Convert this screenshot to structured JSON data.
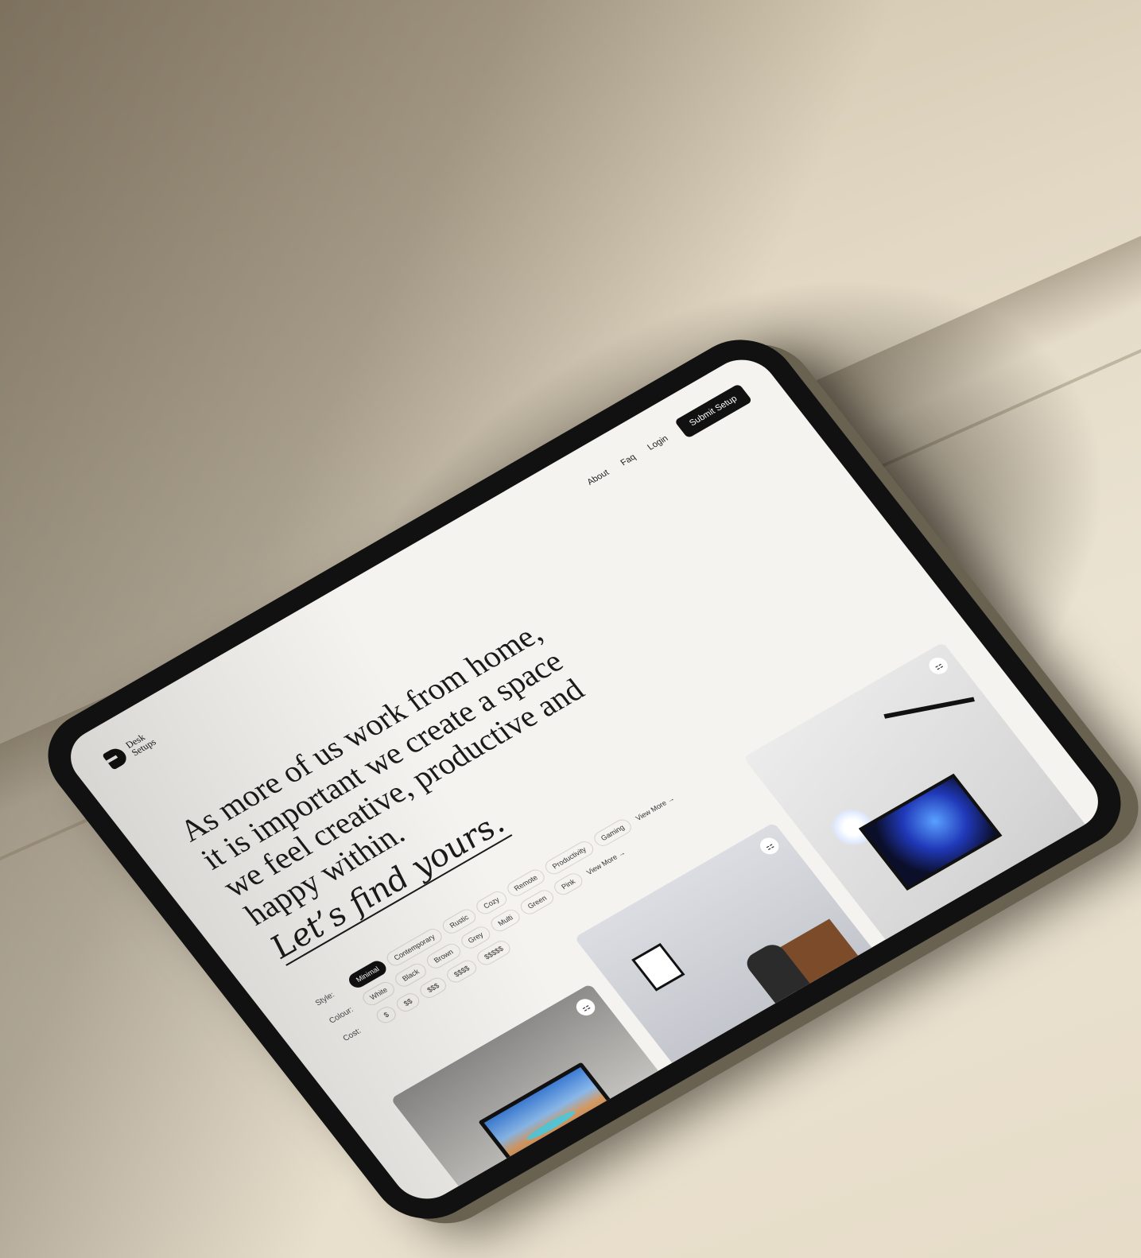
{
  "brand": {
    "line1": "Desk",
    "line2": "Setups"
  },
  "nav": {
    "about": "About",
    "faq": "Faq",
    "login": "Login",
    "submit": "Submit Setup"
  },
  "hero": {
    "headline": "As more of us work from home, it is important we create a space we feel creative, productive and happy within.",
    "cta": "Let’s find yours."
  },
  "filters": {
    "style": {
      "label": "Style:",
      "options": [
        "Minimal",
        "Contemporary",
        "Rustic",
        "Cozy",
        "Remote",
        "Productivity",
        "Gaming"
      ],
      "active": "Minimal",
      "view_more": "View More →"
    },
    "colour": {
      "label": "Colour:",
      "options": [
        "White",
        "Black",
        "Brown",
        "Grey",
        "Multi",
        "Green",
        "Pink"
      ],
      "view_more": "View More →"
    },
    "cost": {
      "label": "Cost:",
      "options": [
        "$",
        "$$",
        "$$$",
        "$$$$",
        "$$$$$"
      ]
    }
  },
  "cards": [
    {
      "bookmark_icon": "bookmark-icon"
    },
    {
      "bookmark_icon": "bookmark-icon"
    },
    {
      "bookmark_icon": "bookmark-icon"
    }
  ],
  "colors": {
    "screen_bg": "#f5f3ef",
    "text": "#1a1a1a",
    "accent": "#111111"
  }
}
